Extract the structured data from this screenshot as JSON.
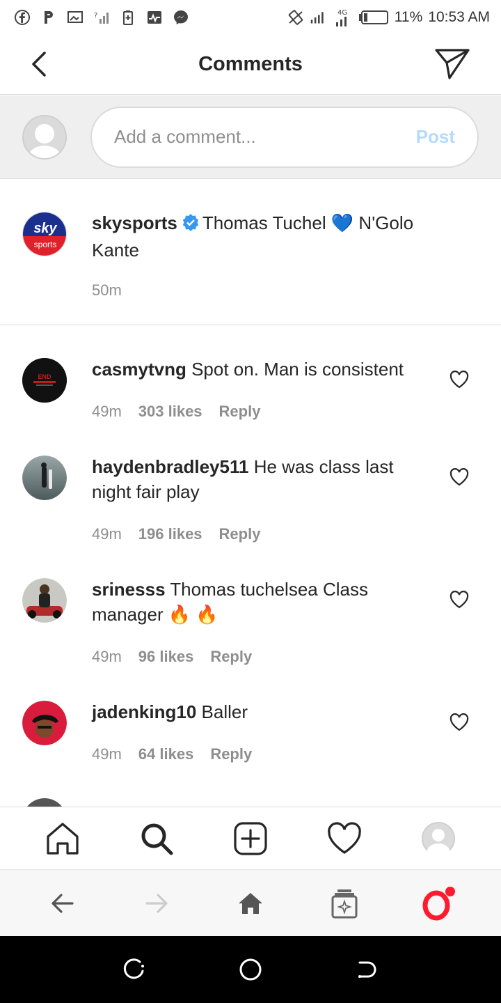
{
  "status_bar": {
    "battery": "11%",
    "time": "10:53 AM",
    "network": "4G"
  },
  "header": {
    "title": "Comments"
  },
  "composer": {
    "placeholder": "Add a comment...",
    "post_label": "Post"
  },
  "caption": {
    "username": "skysports",
    "text_part1": "Thomas Tuchel ",
    "emoji": "💙",
    "text_part2": " N'Golo Kante",
    "time": "50m",
    "avatar_top": "sky",
    "avatar_bottom": "sports"
  },
  "comments": [
    {
      "username": "casmytvng",
      "text": "Spot on. Man is consistent",
      "time": "49m",
      "likes": "303 likes",
      "reply": "Reply",
      "avatar_text": "END"
    },
    {
      "username": "haydenbradley511",
      "text": "He was class last night fair play",
      "time": "49m",
      "likes": "196 likes",
      "reply": "Reply"
    },
    {
      "username": "srinesss",
      "text": "Thomas tuchelsea Class manager 🔥 🔥",
      "time": "49m",
      "likes": "96 likes",
      "reply": "Reply"
    },
    {
      "username": "jadenking10",
      "text": "Baller",
      "time": "49m",
      "likes": "64 likes",
      "reply": "Reply"
    }
  ],
  "colors": {
    "accent_blue": "#0095f6",
    "post_disabled": "#b3dbff",
    "secondary_text": "#8e8e8e",
    "opera_red": "#ff1b2d"
  }
}
